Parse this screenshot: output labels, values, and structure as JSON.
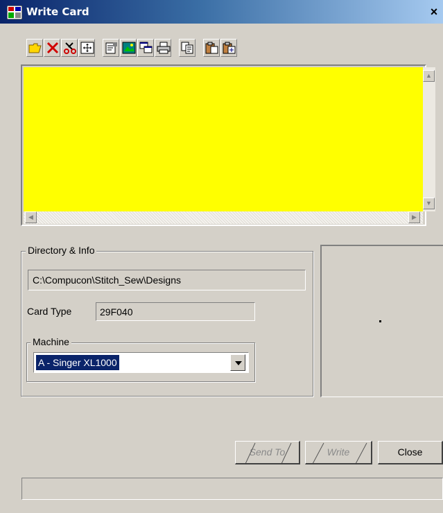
{
  "window": {
    "title": "Write Card",
    "close_glyph": "×"
  },
  "toolbar": {
    "buttons": [
      {
        "name": "open-folder-icon"
      },
      {
        "name": "delete-icon"
      },
      {
        "name": "cut-icon"
      },
      {
        "name": "move-icon"
      },
      {
        "name": "properties-icon"
      },
      {
        "name": "picture-icon"
      },
      {
        "name": "windows-icon"
      },
      {
        "name": "print-icon"
      },
      {
        "name": "copy-icon"
      },
      {
        "name": "paste-icon"
      },
      {
        "name": "paste-special-icon"
      }
    ]
  },
  "preview": {
    "background": "#ffff00"
  },
  "directory": {
    "legend": "Directory & Info",
    "path": "C:\\Compucon\\Stitch_Sew\\Designs",
    "card_type_label": "Card Type",
    "card_type_value": "29F040"
  },
  "machine": {
    "legend": "Machine",
    "selected": "A - Singer XL1000"
  },
  "buttons": {
    "send_to": "Send To",
    "write": "Write",
    "close": "Close"
  },
  "colors": {
    "face": "#d4d0c8",
    "title_start": "#0a246a",
    "selection": "#0a246a"
  }
}
